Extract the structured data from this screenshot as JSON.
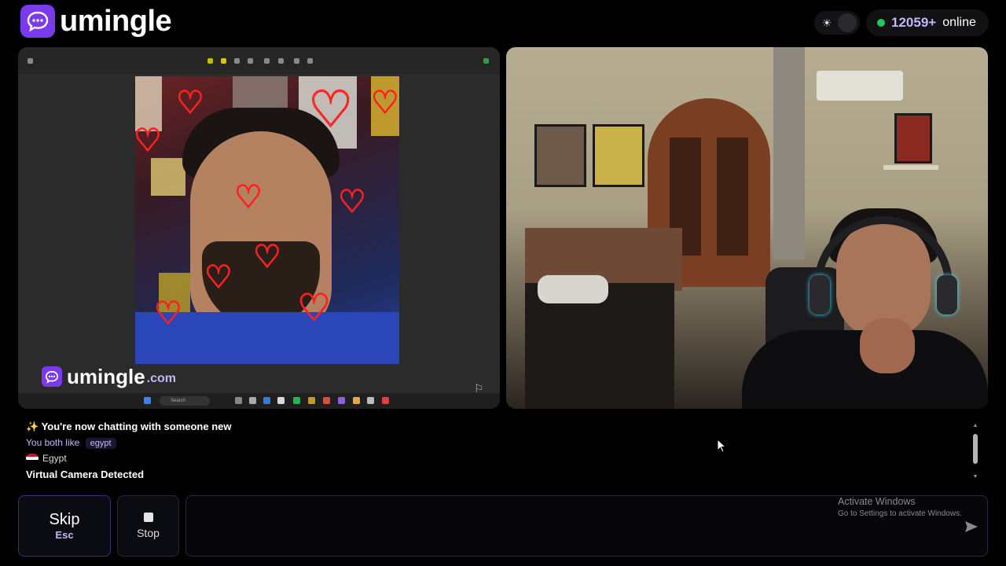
{
  "header": {
    "brand": "umingle",
    "online_count": "12059+",
    "online_label": "online"
  },
  "icons": {
    "logo": "chat-bubble-icon",
    "theme": "sun-icon",
    "send": "send-icon",
    "report": "flag-icon",
    "stop": "stop-square-icon"
  },
  "colors": {
    "accent": "#7c3aed",
    "accent_light": "#c4b5fd",
    "online_green": "#22c55e"
  },
  "watermark": {
    "brand": "umingle",
    "domain": ".com"
  },
  "chat": {
    "new_chat_msg": "You're now chatting with someone new",
    "both_like": "You both like",
    "interest_tag": "egypt",
    "country": "Egypt",
    "status": "Virtual Camera Detected"
  },
  "controls": {
    "skip_label": "Skip",
    "skip_key": "Esc",
    "stop_label": "Stop",
    "message_placeholder": ""
  },
  "os_overlay": {
    "activate_title": "Activate Windows",
    "activate_sub": "Go to Settings to activate Windows."
  },
  "taskbar": {
    "search_text": "Search"
  }
}
